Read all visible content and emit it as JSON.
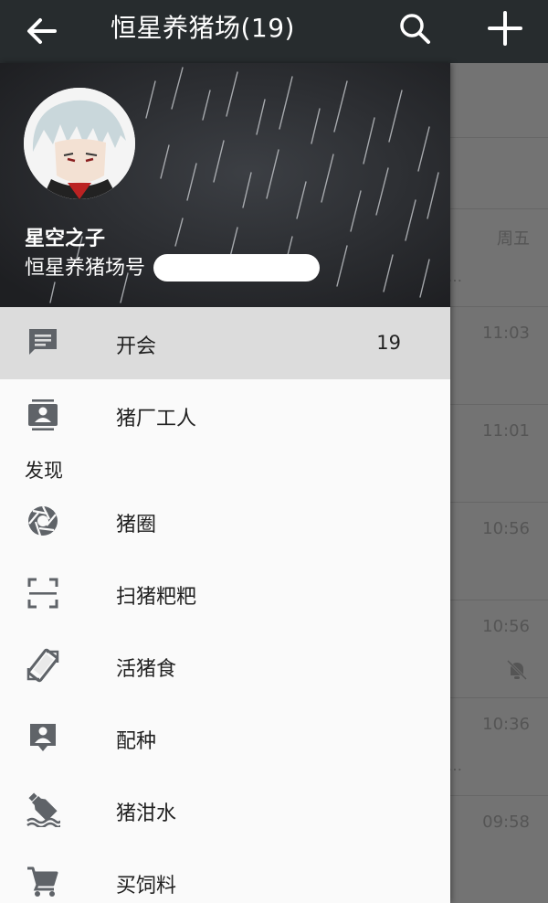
{
  "appbar": {
    "title": "恒星养猪场(19)",
    "back_icon": "arrow-left-icon",
    "search_icon": "search-icon",
    "add_icon": "plus-icon"
  },
  "profile": {
    "name": "星空之子",
    "id_label": "恒星养猪场号"
  },
  "menu": {
    "items": [
      {
        "label": "开会",
        "count": "19",
        "icon": "chat-icon"
      },
      {
        "label": "猪厂工人",
        "icon": "contacts-icon"
      }
    ],
    "discover_section": "发现",
    "discover_items": [
      {
        "label": "猪圈",
        "icon": "aperture-icon"
      },
      {
        "label": "扫猪粑粑",
        "icon": "scan-icon"
      },
      {
        "label": "活猪食",
        "icon": "shake-icon"
      },
      {
        "label": "配种",
        "icon": "person-pin-icon"
      },
      {
        "label": "猪泔水",
        "icon": "drift-bottle-icon"
      },
      {
        "label": "买饲料",
        "icon": "cart-icon"
      }
    ]
  },
  "background_list": {
    "times": [
      "周五",
      "11:03",
      "11:01",
      "10:56",
      "10:56",
      "10:36",
      "09:58"
    ]
  },
  "colors": {
    "appbar": "#272c2e",
    "drawer_bg": "#fafafa",
    "active_item": "#dcdcdc",
    "icon": "#5f6368"
  }
}
